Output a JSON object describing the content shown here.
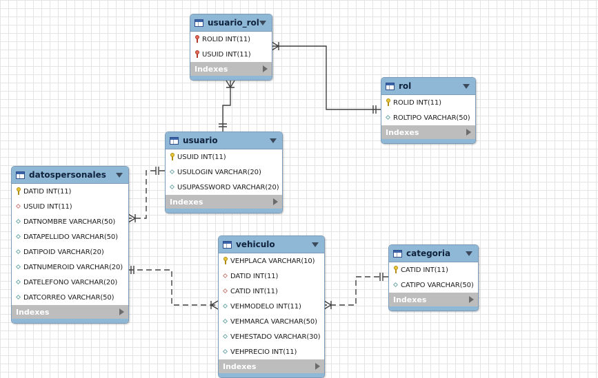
{
  "tables": {
    "usuario_rol": {
      "name": "usuario_rol",
      "indexes_label": "Indexes",
      "columns": [
        {
          "text": "ROLID INT(11)",
          "icon": "foreign-key-icon"
        },
        {
          "text": "USUID INT(11)",
          "icon": "foreign-key-icon"
        }
      ]
    },
    "rol": {
      "name": "rol",
      "indexes_label": "Indexes",
      "columns": [
        {
          "text": "ROLID INT(11)",
          "icon": "primary-key-icon"
        },
        {
          "text": "ROLTIPO VARCHAR(50)",
          "icon": "column-diamond-icon"
        }
      ]
    },
    "usuario": {
      "name": "usuario",
      "indexes_label": "Indexes",
      "columns": [
        {
          "text": "USUID INT(11)",
          "icon": "primary-key-icon"
        },
        {
          "text": "USULOGIN VARCHAR(20)",
          "icon": "column-diamond-icon"
        },
        {
          "text": "USUPASSWORD VARCHAR(20)",
          "icon": "column-diamond-icon"
        }
      ]
    },
    "datospersonales": {
      "name": "datospersonales",
      "indexes_label": "Indexes",
      "columns": [
        {
          "text": "DATID INT(11)",
          "icon": "primary-key-icon"
        },
        {
          "text": "USUID INT(11)",
          "icon": "foreign-column-diamond-icon"
        },
        {
          "text": "DATNOMBRE VARCHAR(50)",
          "icon": "column-diamond-icon"
        },
        {
          "text": "DATAPELLIDO VARCHAR(50)",
          "icon": "column-diamond-icon"
        },
        {
          "text": "DATIPOID VARCHAR(20)",
          "icon": "column-diamond-icon"
        },
        {
          "text": "DATNUMEROID VARCHAR(20)",
          "icon": "column-diamond-icon"
        },
        {
          "text": "DATELEFONO VARCHAR(20)",
          "icon": "column-diamond-icon"
        },
        {
          "text": "DATCORREO VARCHAR(50)",
          "icon": "column-diamond-icon"
        }
      ]
    },
    "vehiculo": {
      "name": "vehiculo",
      "indexes_label": "Indexes",
      "columns": [
        {
          "text": "VEHPLACA VARCHAR(10)",
          "icon": "primary-key-icon"
        },
        {
          "text": "DATID INT(11)",
          "icon": "foreign-column-diamond-icon"
        },
        {
          "text": "CATID INT(11)",
          "icon": "foreign-column-diamond-icon"
        },
        {
          "text": "VEHMODELO INT(11)",
          "icon": "column-diamond-icon"
        },
        {
          "text": "VEHMARCA VARCHAR(50)",
          "icon": "column-diamond-icon"
        },
        {
          "text": "VEHESTADO VARCHAR(30)",
          "icon": "column-diamond-icon"
        },
        {
          "text": "VEHPRECIO INT(11)",
          "icon": "column-diamond-icon"
        }
      ]
    },
    "categoria": {
      "name": "categoria",
      "indexes_label": "Indexes",
      "columns": [
        {
          "text": "CATID INT(11)",
          "icon": "primary-key-icon"
        },
        {
          "text": "CATIPO VARCHAR(50)",
          "icon": "column-diamond-icon"
        }
      ]
    }
  },
  "colors": {
    "header": "#8fb7d6",
    "border": "#7a9ab8",
    "indexes_bar": "#bdbdbd",
    "connector": "#3f3f3f"
  }
}
